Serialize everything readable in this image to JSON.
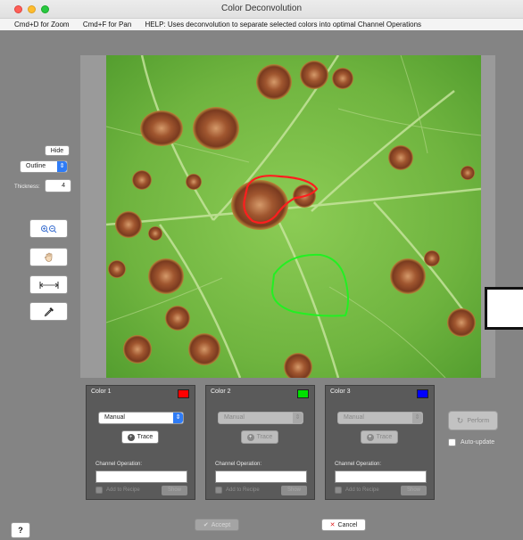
{
  "window": {
    "title": "Color Deconvolution"
  },
  "hints": {
    "zoom": "Cmd+D for Zoom",
    "pan": "Cmd+F for Pan",
    "help": "HELP: Uses deconvolution to separate selected colors into optimal Channel Operations"
  },
  "sidebar": {
    "hide_label": "Hide",
    "outline_value": "Outline",
    "thickness_label": "Thickness:",
    "thickness_value": "4",
    "icons": [
      "zoom-icon",
      "hand-icon",
      "measure-icon",
      "eyedropper-icon"
    ]
  },
  "panels": [
    {
      "title": "Color 1",
      "color": "#ff0000",
      "mode": "Manual",
      "enabled": true,
      "trace_label": "Trace",
      "channel_label": "Channel Operation:",
      "channel_value": "",
      "recipe_label": "Add to Recipe",
      "show_label": "Show"
    },
    {
      "title": "Color 2",
      "color": "#00e000",
      "mode": "Manual",
      "enabled": false,
      "trace_label": "Trace",
      "channel_label": "Channel Operation:",
      "channel_value": "",
      "recipe_label": "Add to Recipe",
      "show_label": "Show"
    },
    {
      "title": "Color 3",
      "color": "#0000ff",
      "mode": "Manual",
      "enabled": false,
      "trace_label": "Trace",
      "channel_label": "Channel Operation:",
      "channel_value": "",
      "recipe_label": "Add to Recipe",
      "show_label": "Show"
    }
  ],
  "actions": {
    "perform_label": "Perform",
    "auto_update_label": "Auto-update",
    "accept_label": "Accept",
    "cancel_label": "Cancel",
    "help_label": "?"
  },
  "colors": {
    "window_bg": "#848484",
    "panel_bg": "#5a5a5a",
    "trace_red": "#ff2020",
    "trace_green": "#22ff22",
    "accent": "#2f7cf6"
  }
}
